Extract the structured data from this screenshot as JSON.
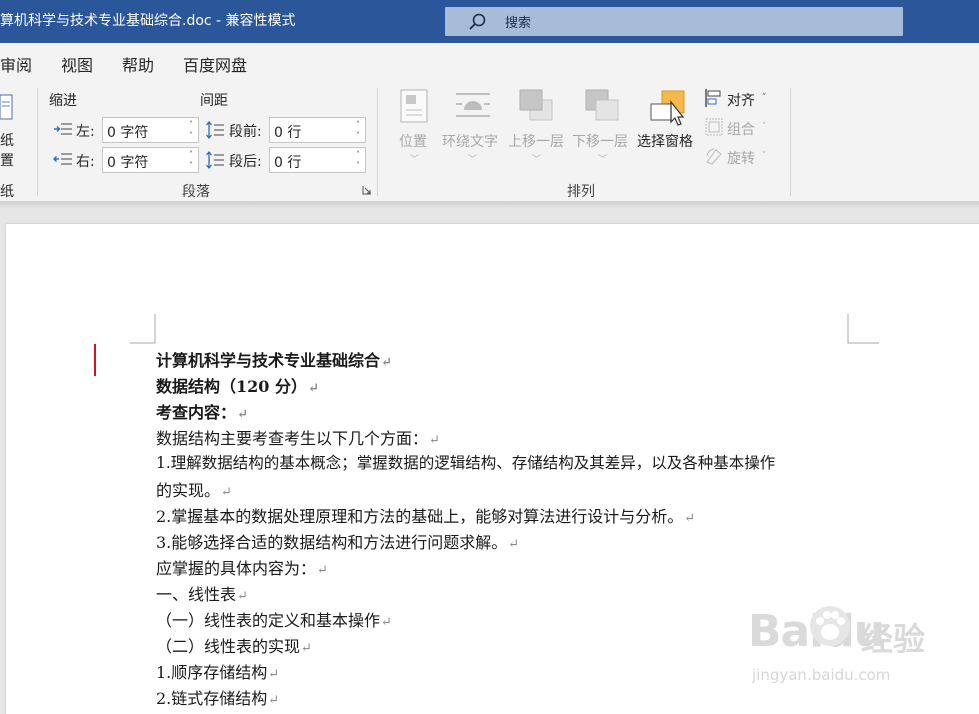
{
  "window": {
    "title": "算机科学与技术专业基础综合.doc  -  兼容性模式",
    "search_label": "搜索"
  },
  "menu": [
    "审阅",
    "视图",
    "帮助",
    "百度网盘"
  ],
  "ribbon": {
    "left_fragment": {
      "line1": "纸",
      "line2": "置",
      "line3": "纸"
    },
    "indent_title": "缩进",
    "spacing_title": "间距",
    "left_label": "左:",
    "right_label": "右:",
    "before_label": "段前:",
    "after_label": "段后:",
    "left_value": "0 字符",
    "right_value": "0 字符",
    "before_value": "0 行",
    "after_value": "0 行",
    "paragraph_group": "段落",
    "arrange": {
      "position": "位置",
      "wrap_text": "环绕文字",
      "bring_forward": "上移一层",
      "send_backward": "下移一层",
      "selection_pane": "选择窗格",
      "align": "对齐",
      "group": "组合",
      "rotate": "旋转"
    },
    "arrange_group": "排列"
  },
  "document": {
    "lines": [
      "计算机科学与技术专业基础综合",
      "数据结构（120 分）",
      "考查内容：",
      "数据结构主要考查考生以下几个方面：",
      "1.理解数据结构的基本概念；掌握数据的逻辑结构、存储结构及其差异，以及各种基本操作",
      "的实现。",
      "2.掌握基本的数据处理原理和方法的基础上，能够对算法进行设计与分析。",
      "3.能够选择合适的数据结构和方法进行问题求解。",
      "应掌握的具体内容为：",
      "一、线性表",
      "（一）线性表的定义和基本操作",
      "（二）线性表的实现",
      "1.顺序存储结构",
      "2.链式存储结构"
    ],
    "paragraph_mark": "↵"
  },
  "watermark": {
    "brand": "Baidu",
    "cn": "经验",
    "url": "jingyan.baidu.com"
  }
}
